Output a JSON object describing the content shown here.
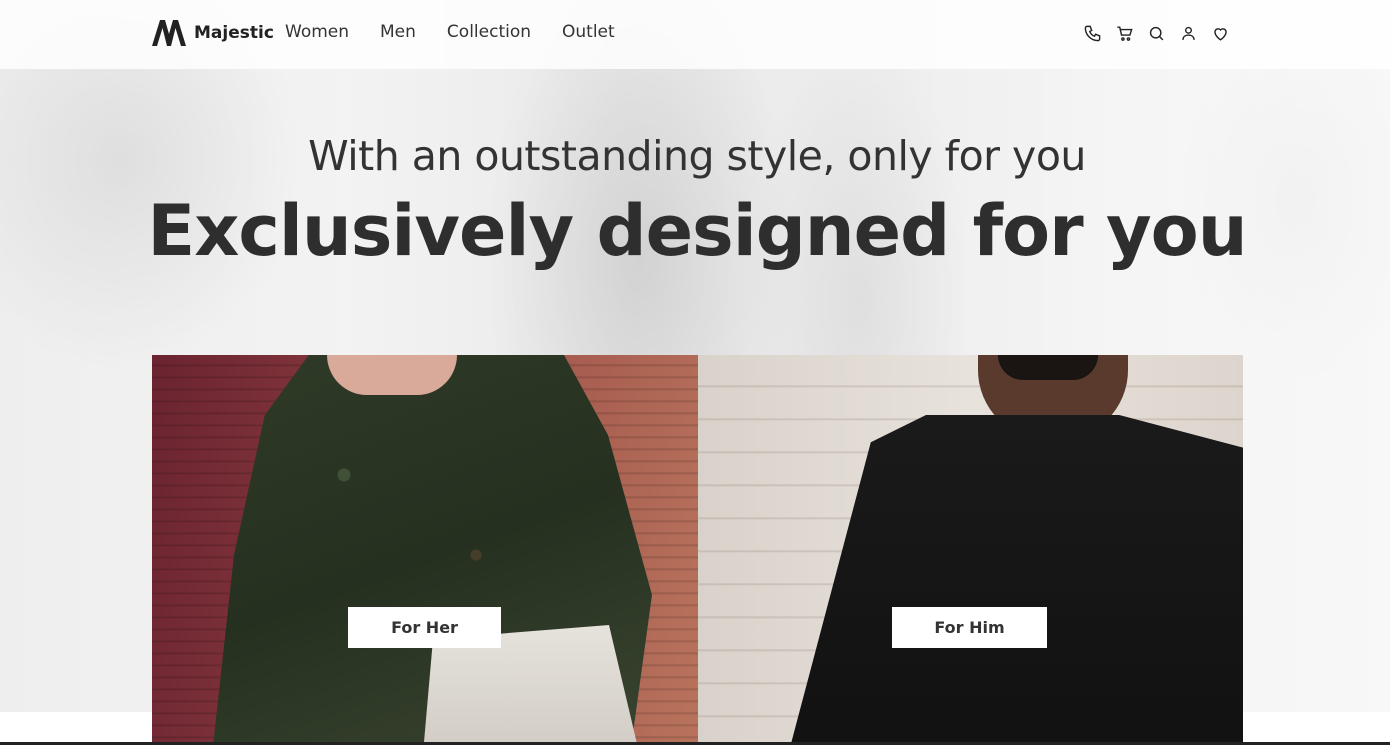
{
  "header": {
    "brand": "Majestic",
    "nav": [
      "Women",
      "Men",
      "Collection",
      "Outlet"
    ],
    "icons": [
      "phone-icon",
      "cart-icon",
      "search-icon",
      "user-icon",
      "heart-icon"
    ]
  },
  "hero": {
    "subtitle": "With an outstanding style, only for you",
    "title": "Exclusively designed for you"
  },
  "categories": [
    {
      "label": "For Her"
    },
    {
      "label": "For Him"
    }
  ],
  "colors": {
    "text": "#2e2e2e",
    "button_bg": "#ffffff",
    "header_bg": "#ffffff"
  }
}
